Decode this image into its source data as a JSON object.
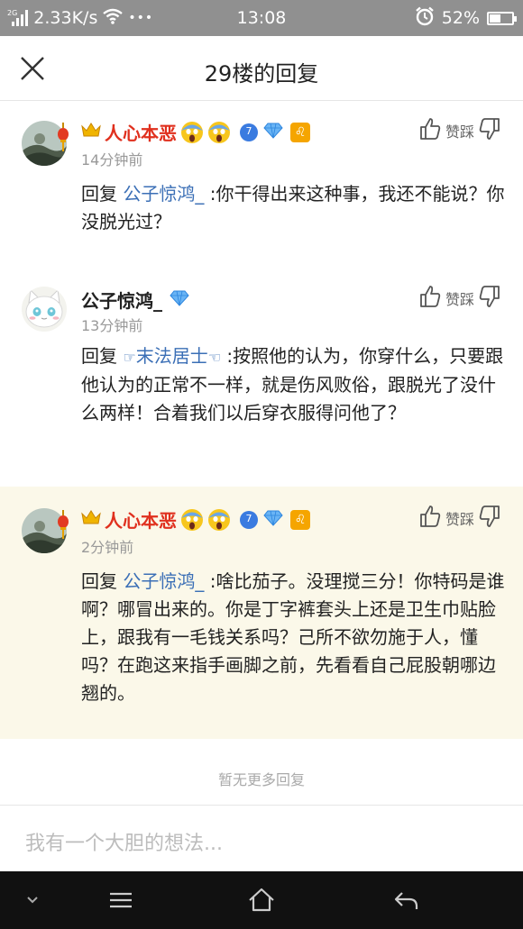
{
  "status_bar": {
    "network_label": "2G",
    "speed": "2.33K/s",
    "more": "•••",
    "time": "13:08",
    "battery": "52%",
    "battery_level": 0.52
  },
  "header": {
    "title": "29楼的回复"
  },
  "comments": [
    {
      "username": "人心本恶",
      "level": "7",
      "zodiac": "♌",
      "time": "14分钟前",
      "vote_label": "赞踩",
      "reply_prefix": "回复",
      "mention": "公子惊鸿_",
      "text": ":你干得出来这种事，我还不能说？你没脱光过？"
    },
    {
      "username": "公子惊鸿_",
      "level": "",
      "time": "13分钟前",
      "vote_label": "赞踩",
      "reply_prefix": "回复",
      "mention_left_hand": "☞",
      "mention": "末法居士",
      "mention_right_hand": "☜",
      "text": ":按照他的认为，你穿什么，只要跟他认为的正常不一样，就是伤风败俗，跟脱光了没什么两样！合着我们以后穿衣服得问他了？"
    },
    {
      "username": "人心本恶",
      "level": "7",
      "zodiac": "♌",
      "time": "2分钟前",
      "vote_label": "赞踩",
      "reply_prefix": "回复",
      "mention": "公子惊鸿_",
      "text": ":啥比茄子。没理搅三分！你特码是谁啊？哪冒出来的。你是丁字裤套头上还是卫生巾贴脸上，跟我有一毛钱关系吗？己所不欲勿施于人，懂吗？在跑这来指手画脚之前，先看看自己屁股朝哪边翘的。"
    }
  ],
  "footer": {
    "no_more": "暂无更多回复"
  },
  "input": {
    "placeholder": "我有一个大胆的想法..."
  },
  "colors": {
    "accent_red": "#e0301e",
    "mention_blue": "#3b6fb6",
    "highlight_bg": "#fbf8e9"
  }
}
